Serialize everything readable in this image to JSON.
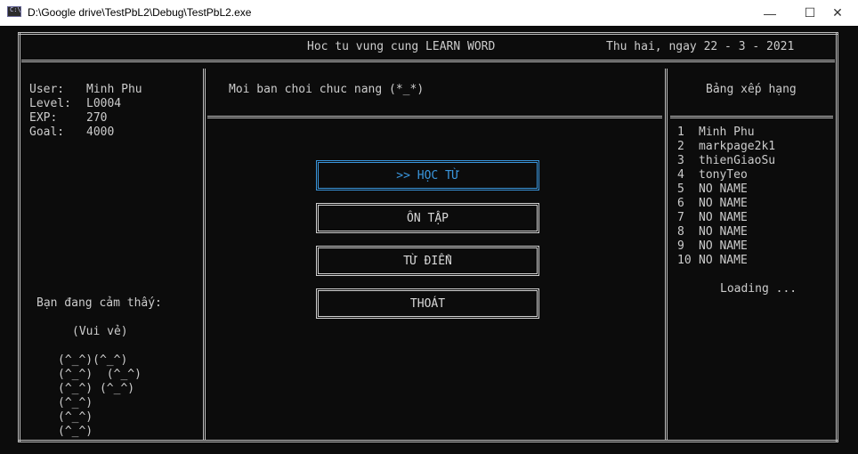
{
  "window": {
    "title": "D:\\Google drive\\TestPbL2\\Debug\\TestPbL2.exe",
    "icon_label": "C:\\",
    "minimize_glyph": "—",
    "maximize_glyph": "☐",
    "close_glyph": "✕"
  },
  "header": {
    "app_title": "Hoc tu vung cung LEARN WORD",
    "date": "Thu hai, ngay 22 - 3 - 2021"
  },
  "user": {
    "user_label": "User:",
    "user_value": "Minh Phu",
    "level_label": "Level:",
    "level_value": "L0004",
    "exp_label": "EXP:",
    "exp_value": "270",
    "goal_label": "Goal:",
    "goal_value": "4000"
  },
  "mood": {
    "prompt": "Bạn đang cảm thấy:",
    "state": "(Vui vẻ)",
    "art": [
      "(^_^)(^_^)",
      "(^_^)  (^_^)",
      "(^_^) (^_^)",
      "(^_^)",
      "(^_^)",
      "(^_^)"
    ]
  },
  "menu": {
    "prompt": "Moi ban choi chuc nang (*_*)",
    "items": [
      {
        "label": ">>  HỌC TỪ",
        "selected": true
      },
      {
        "label": "ÔN TẬP",
        "selected": false
      },
      {
        "label": "TỪ ĐIỂN",
        "selected": false
      },
      {
        "label": "THOÁT",
        "selected": false
      }
    ]
  },
  "leaderboard": {
    "title": "Bảng xếp hạng",
    "rows": [
      {
        "rank": "1",
        "name": "Minh Phu"
      },
      {
        "rank": "2",
        "name": "markpage2k1"
      },
      {
        "rank": "3",
        "name": "thienGiaoSu"
      },
      {
        "rank": "4",
        "name": "tonyTeo"
      },
      {
        "rank": "5",
        "name": "NO NAME"
      },
      {
        "rank": "6",
        "name": "NO NAME"
      },
      {
        "rank": "7",
        "name": "NO NAME"
      },
      {
        "rank": "8",
        "name": "NO NAME"
      },
      {
        "rank": "9",
        "name": "NO NAME"
      },
      {
        "rank": "10",
        "name": "NO NAME"
      }
    ],
    "loading": "Loading ..."
  },
  "colors": {
    "console_bg": "#0c0c0c",
    "text": "#cccccc",
    "selected": "#3a96dd"
  }
}
